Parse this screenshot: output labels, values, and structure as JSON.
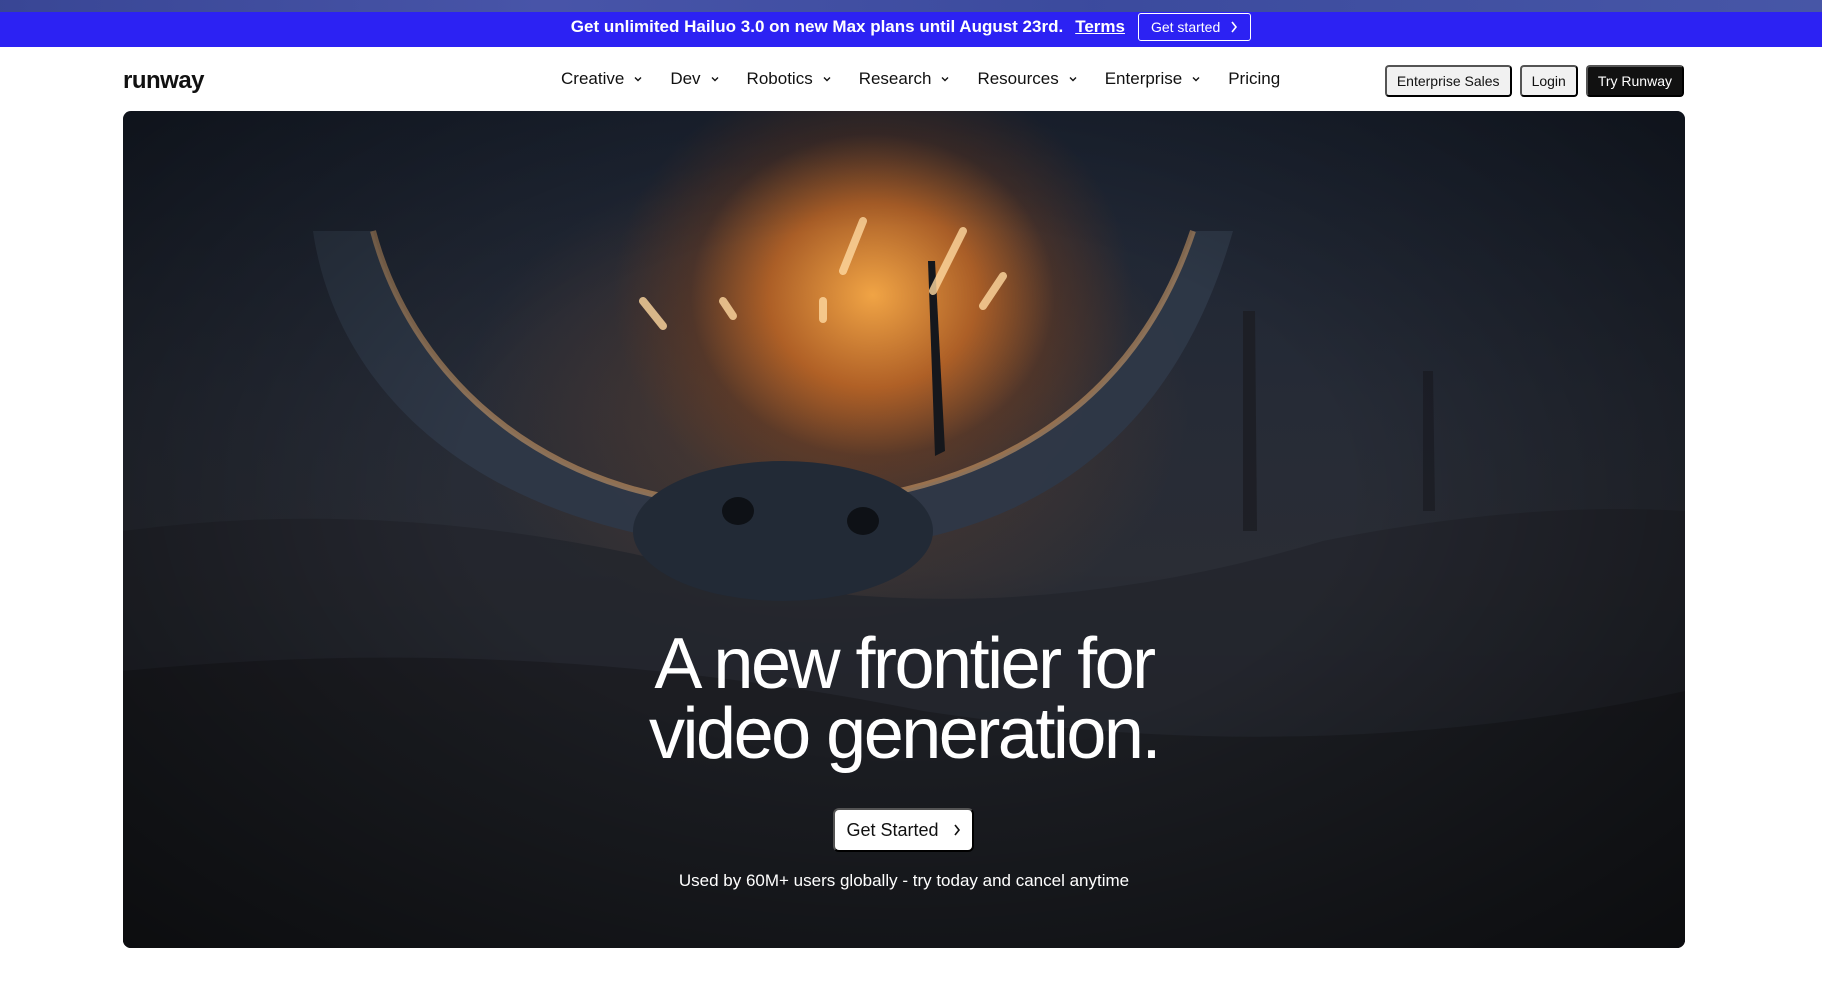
{
  "promo": {
    "text": "Get unlimited Hailuo 3.0 on new Max plans until August 23rd.",
    "terms_label": "Terms",
    "cta_label": "Get started",
    "cta_icon": "chevron-right-icon",
    "bg_color": "#2c22f3"
  },
  "nav": {
    "logo": "runway",
    "links": [
      {
        "label": "Creative",
        "icon": "chevron-down-icon"
      },
      {
        "label": "Dev",
        "icon": "chevron-down-icon"
      },
      {
        "label": "Robotics",
        "icon": "chevron-down-icon"
      },
      {
        "label": "Research",
        "icon": "chevron-down-icon"
      },
      {
        "label": "Resources",
        "icon": "chevron-down-icon"
      },
      {
        "label": "Enterprise",
        "icon": "chevron-down-icon"
      },
      {
        "label": "Pricing",
        "icon": null
      }
    ],
    "enterprise_sales_label": "Enterprise Sales",
    "login_label": "Login",
    "try_label": "Try Runway"
  },
  "hero": {
    "title_line1": "A new frontier for",
    "title_line2": "video generation.",
    "cta_label": "Get Started",
    "cta_icon": "chevron-right-icon",
    "subtext": "Used by 60M+ users globally - try today and cancel anytime"
  }
}
